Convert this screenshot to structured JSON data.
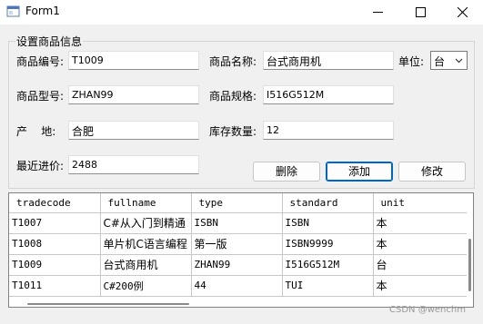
{
  "window": {
    "title": "Form1",
    "minimize_icon": "minimize-icon",
    "maximize_icon": "maximize-icon",
    "close_icon": "close-icon"
  },
  "group": {
    "title": "设置商品信息",
    "code_label": "商品编号:",
    "code_value": "T1009",
    "name_label": "商品名称:",
    "name_value": "台式商用机",
    "unit_label": "单位:",
    "unit_value": "台",
    "model_label": "商品型号:",
    "model_value": "ZHAN99",
    "spec_label": "商品规格:",
    "spec_value": "I516G512M",
    "origin_label": "产    地:",
    "origin_value": "合肥",
    "stock_label": "库存数量:",
    "stock_value": "12",
    "price_label": "最近进价:",
    "price_value": "2488"
  },
  "buttons": {
    "delete": "删除",
    "add": "添加",
    "edit": "修改"
  },
  "grid": {
    "columns": [
      "tradecode",
      "fullname",
      "type",
      "standard",
      "unit"
    ],
    "rows": [
      [
        "T1007",
        "C#从入门到精通",
        "ISBN",
        "ISBN",
        "本"
      ],
      [
        "T1008",
        "单片机C语言编程",
        "第一版",
        "ISBN9999",
        "本"
      ],
      [
        "T1009",
        "台式商用机",
        "ZHAN99",
        "I516G512M",
        "台"
      ],
      [
        "T1011",
        "C#200例",
        "44",
        "TUI",
        "本"
      ]
    ]
  },
  "watermark": "CSDN @wenchm"
}
